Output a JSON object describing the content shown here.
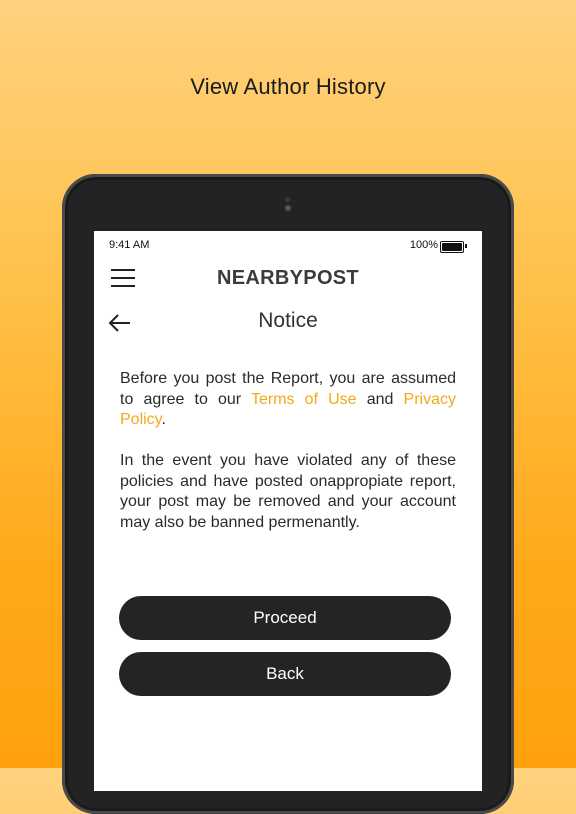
{
  "headline": "View Author History",
  "status_bar": {
    "time": "9:41 AM",
    "battery": "100%"
  },
  "header": {
    "brand": "NEARBYPOST",
    "page_title": "Notice"
  },
  "notice": {
    "p1_part1": "Before you post the Report, you are assumed to agree to our ",
    "terms_link": "Terms of Use",
    "p1_and": " and ",
    "privacy_link": "Privacy Policy",
    "p1_end": ".",
    "p2": "In the event you have violated any of these policies and have posted onappropiate report, your post may be removed and your account may also be banned permenantly."
  },
  "buttons": {
    "proceed": "Proceed",
    "back": "Back"
  },
  "colors": {
    "accent": "#f2a81c",
    "button_bg": "#242424"
  },
  "icons": [
    "menu-icon",
    "back-arrow-icon",
    "battery-icon"
  ]
}
